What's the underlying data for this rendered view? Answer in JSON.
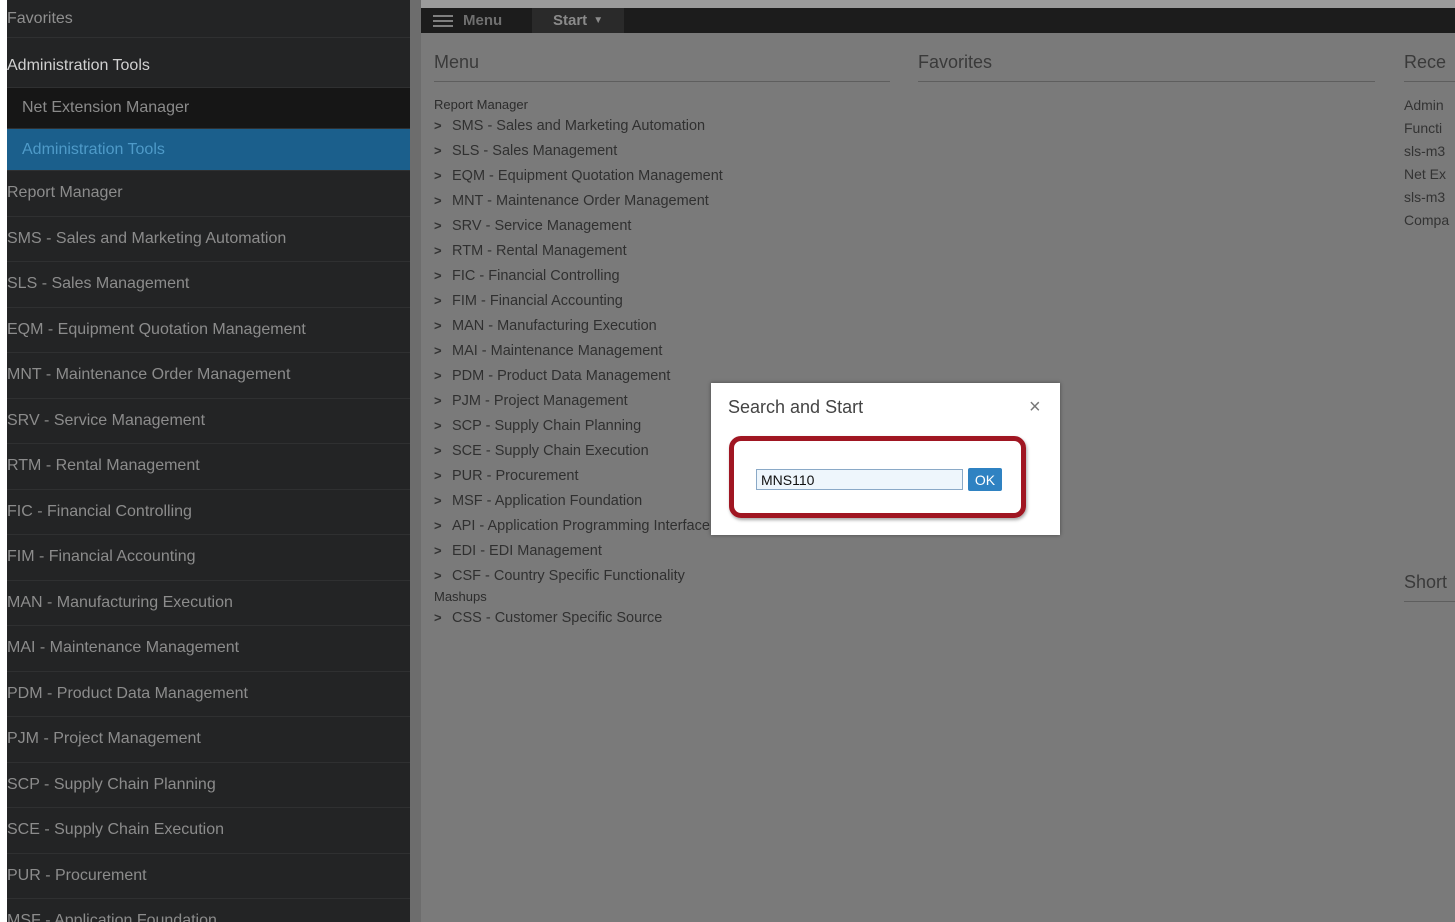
{
  "sidebar": {
    "favorites_label": "Favorites",
    "admin_tools_header": "Administration Tools",
    "sub_items": [
      "Net Extension Manager",
      "Administration Tools"
    ],
    "items": [
      "Report Manager",
      "SMS - Sales and Marketing Automation",
      "SLS - Sales Management",
      "EQM - Equipment Quotation Management",
      "MNT - Maintenance Order Management",
      "SRV - Service Management",
      "RTM - Rental Management",
      "FIC - Financial Controlling",
      "FIM - Financial Accounting",
      "MAN - Manufacturing Execution",
      "MAI - Maintenance Management",
      "PDM - Product Data Management",
      "PJM - Project Management",
      "SCP - Supply Chain Planning",
      "SCE - Supply Chain Execution",
      "PUR - Procurement",
      "MSF - Application Foundation"
    ]
  },
  "topbar": {
    "menu_label": "Menu",
    "start_label": "Start",
    "hamburger_icon": "hamburger-icon",
    "caret_icon": "caret-down-icon"
  },
  "panels": {
    "menu_title": "Menu",
    "favorites_title": "Favorites",
    "recent_title": "Rece",
    "shortcuts_title": "Short"
  },
  "menu_tree": {
    "report_manager_label": "Report Manager",
    "report_manager_items": [
      "SMS - Sales and Marketing Automation",
      "SLS - Sales Management",
      "EQM - Equipment Quotation Management",
      "MNT - Maintenance Order Management",
      "SRV - Service Management",
      "RTM - Rental Management",
      "FIC - Financial Controlling",
      "FIM - Financial Accounting",
      "MAN - Manufacturing Execution",
      "MAI - Maintenance Management",
      "PDM - Product Data Management",
      "PJM - Project Management",
      "SCP - Supply Chain Planning",
      "SCE - Supply Chain Execution",
      "PUR - Procurement",
      "MSF - Application Foundation",
      "API - Application Programming Interface",
      "EDI - EDI Management",
      "CSF - Country Specific Functionality"
    ],
    "mashups_label": "Mashups",
    "mashups_items": [
      "CSS - Customer Specific Source"
    ]
  },
  "recent": [
    "Admin",
    "Functi",
    "sls-m3",
    "Net Ex",
    "sls-m3",
    "Compa"
  ],
  "modal": {
    "title": "Search and Start",
    "close_symbol": "×",
    "input_value": "MNS110",
    "ok_label": "OK",
    "highlight_color": "#a01622"
  },
  "colors": {
    "sidebar_bg": "#232425",
    "active_item_bg": "#1b5f8c",
    "main_bg": "#7a7a7a",
    "ok_button": "#2f82c2"
  }
}
